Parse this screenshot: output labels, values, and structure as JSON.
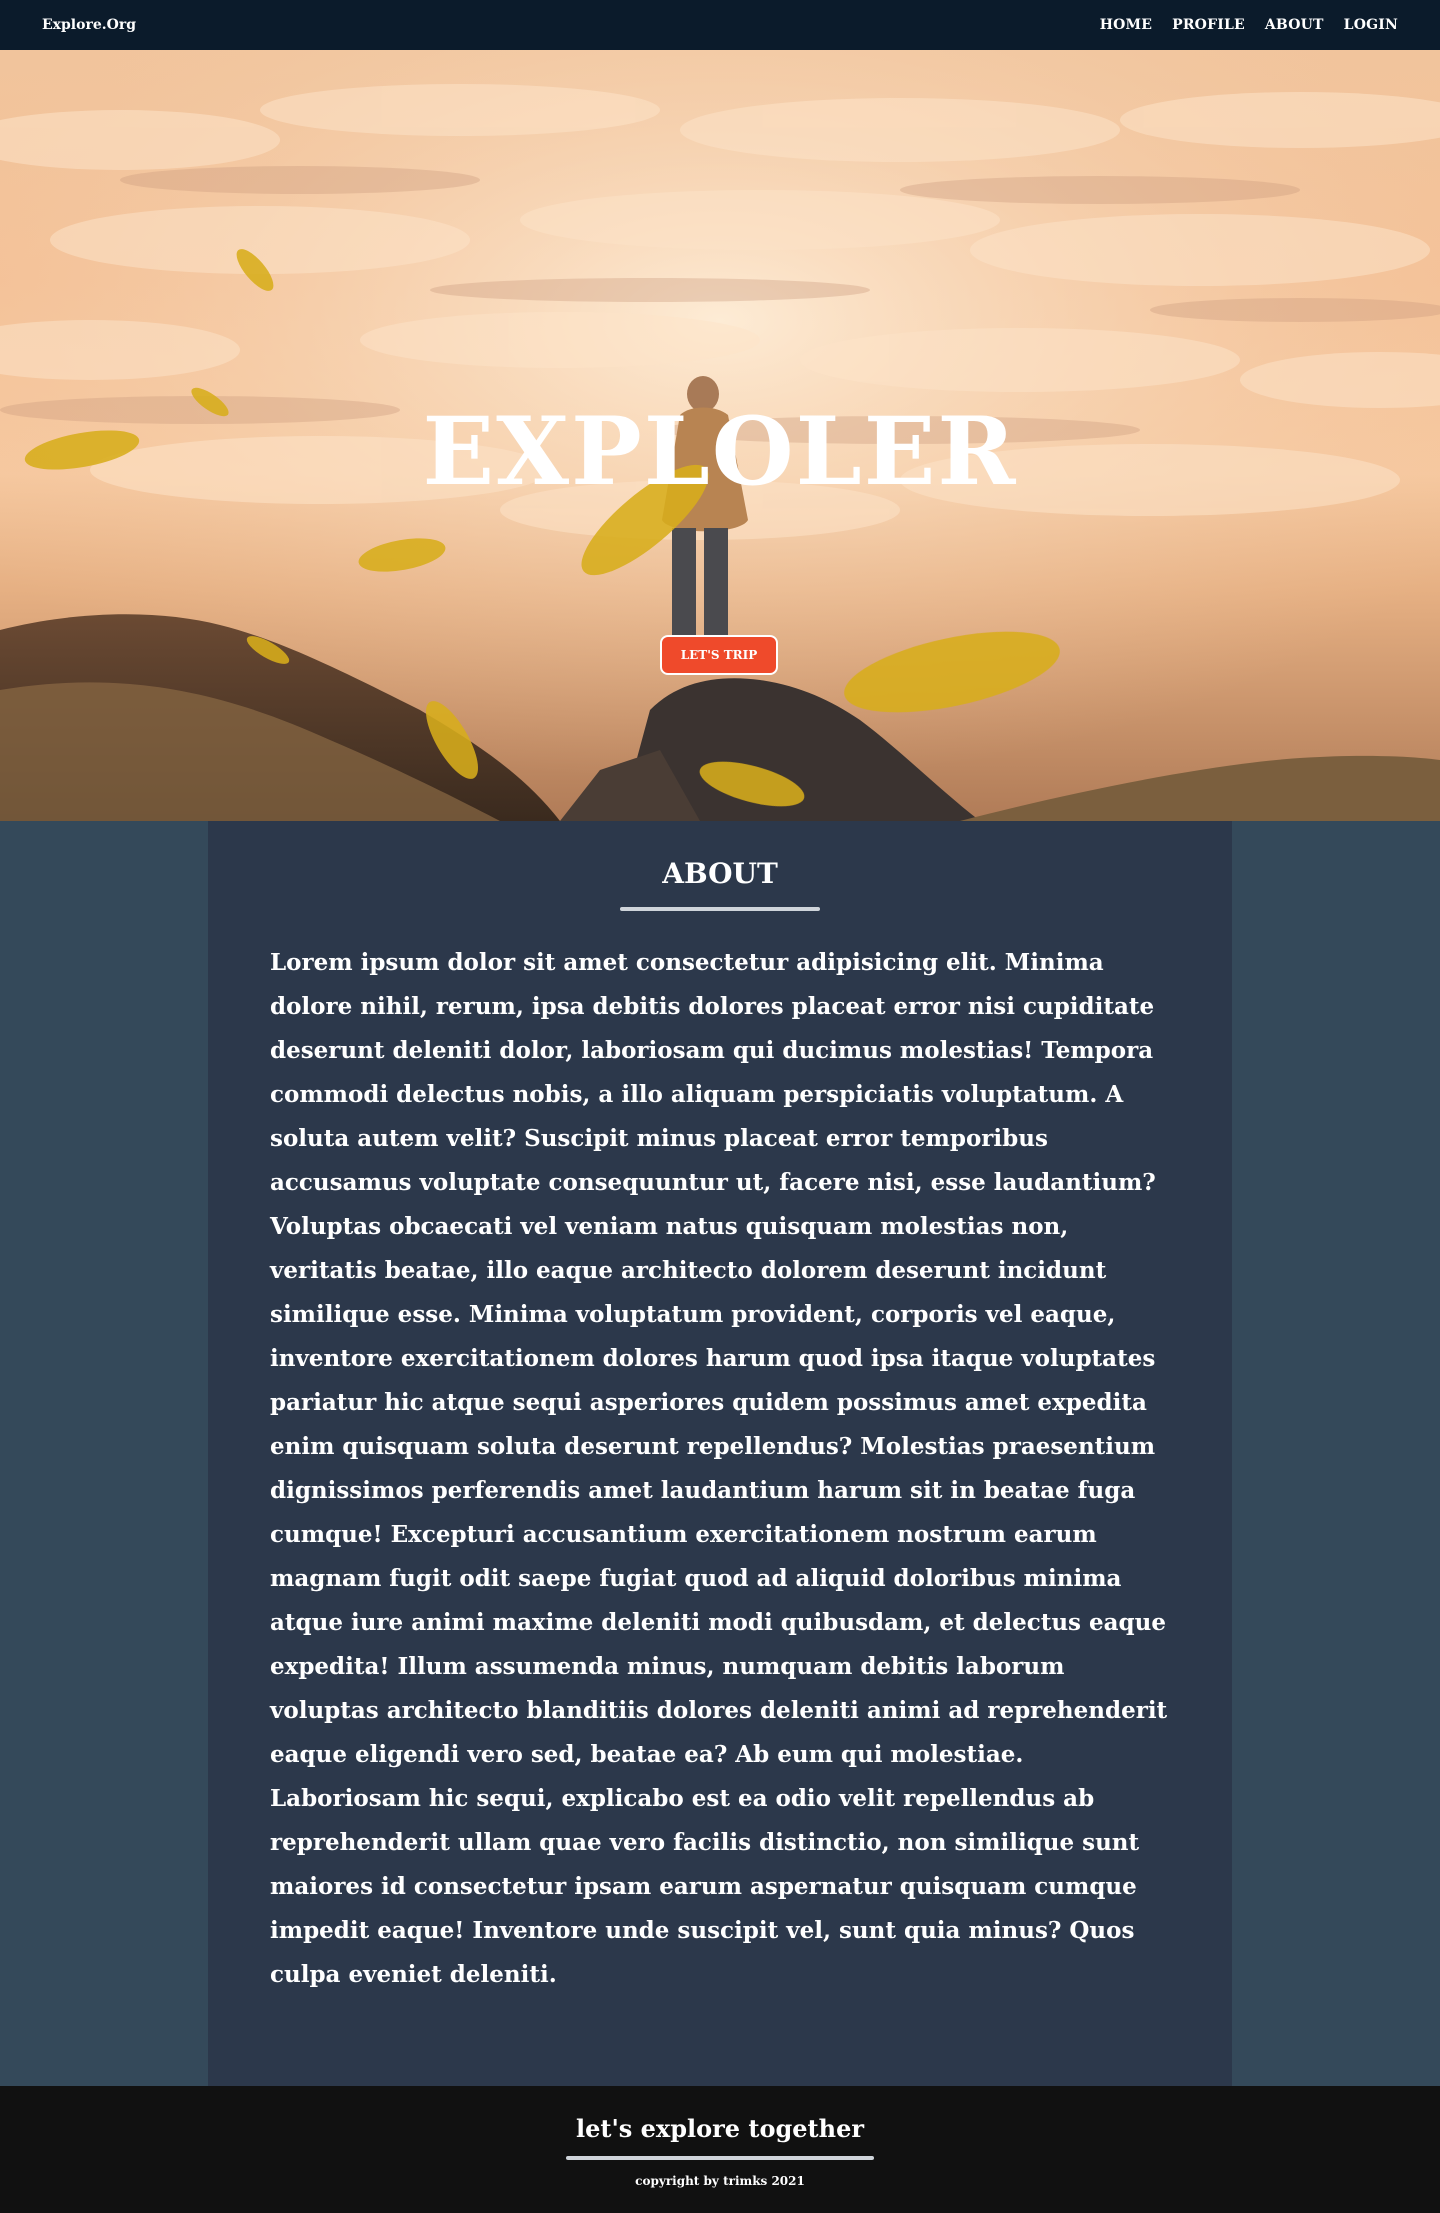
{
  "navbar": {
    "brand": "Explore.Org",
    "links": [
      "HOME",
      "PROFILE",
      "ABOUT",
      "LOGIN"
    ]
  },
  "hero": {
    "title": "EXPLOLER",
    "button_label": "LET'S TRIP"
  },
  "about": {
    "title": "ABOUT",
    "text": "Lorem ipsum dolor sit amet consectetur adipisicing elit. Minima dolore nihil, rerum, ipsa debitis dolores placeat error nisi cupiditate deserunt deleniti dolor, laboriosam qui ducimus molestias! Tempora commodi delectus nobis, a illo aliquam perspiciatis voluptatum. A soluta autem velit? Suscipit minus placeat error temporibus accusamus voluptate consequuntur ut, facere nisi, esse laudantium? Voluptas obcaecati vel veniam natus quisquam molestias non, veritatis beatae, illo eaque architecto dolorem deserunt incidunt similique esse. Minima voluptatum provident, corporis vel eaque, inventore exercitationem dolores harum quod ipsa itaque voluptates pariatur hic atque sequi asperiores quidem possimus amet expedita enim quisquam soluta deserunt repellendus? Molestias praesentium dignissimos perferendis amet laudantium harum sit in beatae fuga cumque! Excepturi accusantium exercitationem nostrum earum magnam fugit odit saepe fugiat quod ad aliquid doloribus minima atque iure animi maxime deleniti modi quibusdam, et delectus eaque expedita! Illum assumenda minus, numquam debitis laborum voluptas architecto blanditiis dolores deleniti animi ad reprehenderit eaque eligendi vero sed, beatae ea? Ab eum qui molestiae. Laboriosam hic sequi, explicabo est ea odio velit repellendus ab reprehenderit ullam quae vero facilis distinctio, non similique sunt maiores id consectetur ipsam earum aspernatur quisquam cumque impedit eaque! Inventore unde suscipit vel, sunt quia minus? Quos culpa eveniet deleniti."
  },
  "footer": {
    "title": "let's explore together",
    "copyright": "copyright by trimks 2021"
  },
  "colors": {
    "navbar_bg": "#0b1b2b",
    "page_bg": "#34495a",
    "panel_bg": "#2c384b",
    "button_accent": "#ef4a2b",
    "footer_bg": "#111111",
    "leaf": "#d8ad1c"
  }
}
